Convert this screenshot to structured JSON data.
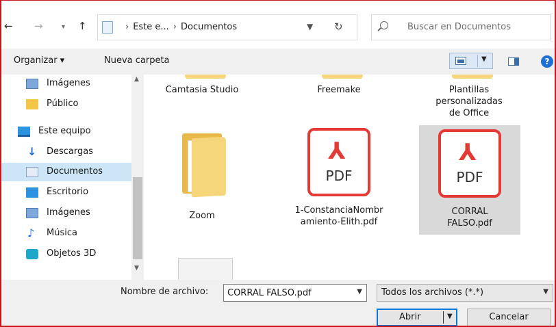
{
  "address": {
    "crumbs": [
      "Este e...",
      "Documentos"
    ],
    "search_placeholder": "Buscar en Documentos"
  },
  "toolbar": {
    "organizar_label": "Organizar ▾",
    "nueva_carpeta_label": "Nueva carpeta"
  },
  "sidebar": {
    "items": [
      {
        "label": "Imágenes",
        "icon": "pictures-icon"
      },
      {
        "label": "Público",
        "icon": "folder-icon"
      },
      {
        "label": "Este equipo",
        "icon": "computer-icon"
      },
      {
        "label": "Descargas",
        "icon": "downloads-icon"
      },
      {
        "label": "Documentos",
        "icon": "documents-icon",
        "selected": true
      },
      {
        "label": "Escritorio",
        "icon": "desktop-icon"
      },
      {
        "label": "Imágenes",
        "icon": "pictures-icon"
      },
      {
        "label": "Música",
        "icon": "music-icon"
      },
      {
        "label": "Objetos 3D",
        "icon": "3d-objects-icon"
      }
    ]
  },
  "files": {
    "row1": [
      "Camtasia Studio",
      "Freemake",
      "Plantillas personalizadas de Office"
    ],
    "row2": [
      {
        "name": "Zoom",
        "type": "folder"
      },
      {
        "name": "1-ConstanciaNombramiento-Elith.pdf",
        "type": "pdf",
        "badge": "PDF"
      },
      {
        "name": "CORRAL FALSO.pdf",
        "type": "pdf",
        "badge": "PDF",
        "selected": true
      }
    ]
  },
  "bottom": {
    "filename_label": "Nombre de archivo:",
    "filename_value": "CORRAL FALSO.pdf",
    "filter_value": "Todos los archivos (*.*)",
    "open_label": "Abrir",
    "cancel_label": "Cancelar"
  },
  "colors": {
    "accent": "#0078d7",
    "selection": "#cde6f7",
    "pdf_red": "#e53935",
    "border_red": "#c4161c"
  }
}
